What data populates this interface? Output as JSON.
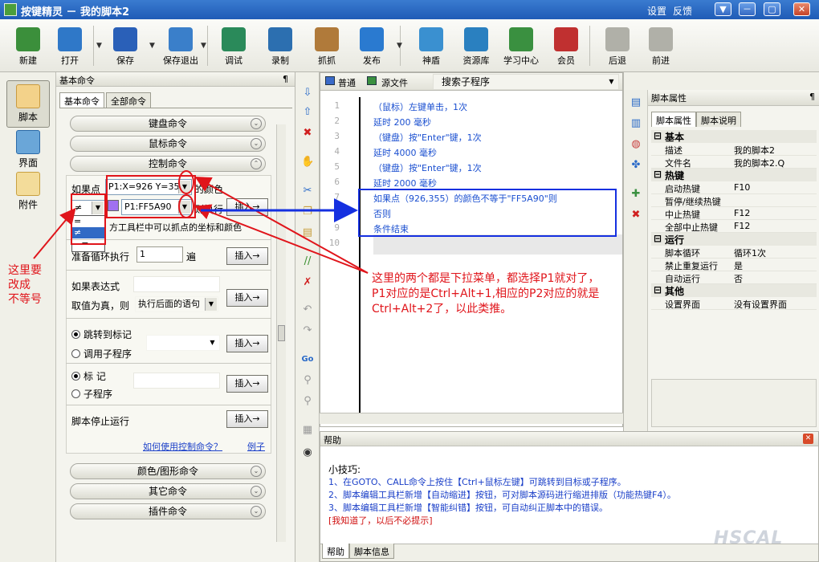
{
  "window": {
    "title": "按键精灵 － 我的脚本2",
    "settings_label": "设置",
    "feedback_label": "反馈",
    "min_label": "▼",
    "restore_label": "－",
    "max_label": "▢",
    "close_label": "✕"
  },
  "toolbar": {
    "items": [
      {
        "label": "新建",
        "icon": "new-file-icon",
        "color": "#3b8f3b"
      },
      {
        "label": "打开",
        "icon": "open-folder-icon",
        "color": "#2f78c8"
      },
      {
        "label": "保存",
        "icon": "save-disk-icon",
        "color": "#2a60b8"
      },
      {
        "label": "保存退出",
        "icon": "save-exit-icon",
        "color": "#3a7fca"
      },
      {
        "label": "调试",
        "icon": "debug-icon",
        "color": "#2a8a5a"
      },
      {
        "label": "录制",
        "icon": "record-camera-icon",
        "color": "#2c6fb0"
      },
      {
        "label": "抓抓",
        "icon": "grab-hand-icon",
        "color": "#b07a3a"
      },
      {
        "label": "发布",
        "icon": "publish-globe-icon",
        "color": "#2a7ad0"
      },
      {
        "label": "神盾",
        "icon": "shield-icon",
        "color": "#3a90d0"
      },
      {
        "label": "资源库",
        "icon": "resource-library-icon",
        "color": "#2a80c0"
      },
      {
        "label": "学习中心",
        "icon": "study-center-icon",
        "color": "#3a9040"
      },
      {
        "label": "会员",
        "icon": "member-icon",
        "color": "#c03030"
      },
      {
        "label": "后退",
        "icon": "back-arrow-icon",
        "color": "#b0b0a8"
      },
      {
        "label": "前进",
        "icon": "forward-arrow-icon",
        "color": "#b0b0a8"
      }
    ]
  },
  "leftbar": {
    "items": [
      {
        "label": "脚本",
        "icon": "script-icon"
      },
      {
        "label": "界面",
        "icon": "interface-icon"
      },
      {
        "label": "附件",
        "icon": "attachment-icon"
      }
    ]
  },
  "cmdpanel": {
    "title": "基本命令",
    "pin": "¶",
    "tabs": [
      "基本命令",
      "全部命令"
    ],
    "bars_top": [
      "键盘命令",
      "鼠标命令",
      "控制命令"
    ],
    "bars_bottom": [
      "颜色/图形命令",
      "其它命令",
      "插件命令"
    ],
    "if_point_label": "如果点",
    "point_select_value": "P1:X=926 Y=355",
    "color_suffix": "的颜色",
    "operator_select_value": "≠",
    "operator_options": [
      "=",
      "≠",
      "~="
    ],
    "color_select_value": "P1:FF5A90",
    "then_label": "则执行",
    "hint_text": "方工具栏中可以抓点的坐标和颜色",
    "loop_label": "准备循环执行",
    "loop_value": "1",
    "loop_unit": "遍",
    "expr_label": "如果表达式",
    "true_label": "取值为真，则",
    "true_select": "执行后面的语句",
    "jump_label": "跳转到标记",
    "call_label": "调用子程序",
    "mark_label": "标 记",
    "sub_label": "子程序",
    "stop_label": "脚本停止运行",
    "insert_label": "插入→",
    "howto_link": "如何使用控制命令？",
    "example_link": "例子"
  },
  "editor": {
    "tab_normal": "普通",
    "tab_source": "源文件",
    "search_label": "搜索子程序",
    "lines": [
      {
        "n": "1",
        "text": "（鼠标）左键单击，1次"
      },
      {
        "n": "2",
        "text": "延时 200 毫秒"
      },
      {
        "n": "3",
        "text": "（键盘）按\"Enter\"键，1次"
      },
      {
        "n": "4",
        "text": "延时 4000 毫秒"
      },
      {
        "n": "5",
        "text": "（键盘）按\"Enter\"键，1次"
      },
      {
        "n": "6",
        "text": "延时 2000 毫秒"
      },
      {
        "n": "7",
        "text": "如果点（926,355）的颜色不等于\"FF5A90\"则"
      },
      {
        "n": "8",
        "text": "否则"
      },
      {
        "n": "9",
        "text": "条件结束"
      },
      {
        "n": "10",
        "text": ""
      }
    ]
  },
  "props": {
    "title": "脚本属性",
    "tabs": [
      "脚本属性",
      "脚本说明"
    ],
    "groups": [
      {
        "name": "基本",
        "rows": [
          {
            "k": "描述",
            "v": "我的脚本2"
          },
          {
            "k": "文件名",
            "v": "我的脚本2.Q"
          }
        ]
      },
      {
        "name": "热键",
        "rows": [
          {
            "k": "启动热键",
            "v": "F10"
          },
          {
            "k": "暂停/继续热键",
            "v": ""
          },
          {
            "k": "中止热键",
            "v": "F12"
          },
          {
            "k": "全部中止热键",
            "v": "F12"
          }
        ]
      },
      {
        "name": "运行",
        "rows": [
          {
            "k": "脚本循环",
            "v": "循环1次"
          },
          {
            "k": "禁止重复运行",
            "v": "是"
          },
          {
            "k": "自动运行",
            "v": "否"
          }
        ]
      },
      {
        "name": "其他",
        "rows": [
          {
            "k": "设置界面",
            "v": "没有设置界面"
          }
        ]
      }
    ]
  },
  "help": {
    "title": "帮助",
    "tips": [
      "小技巧:",
      "1、在GOTO、CALL命令上按住【Ctrl+鼠标左键】可跳转到目标或子程序。",
      "2、脚本编辑工具栏新增【自动缩进】按钮，可对脚本源码进行缩进排版（功能热键F4）。",
      "3、脚本编辑工具栏新增【智能纠错】按钮，可自动纠正脚本中的错误。"
    ],
    "dismiss": "[我知道了，以后不必提示]",
    "tabs": [
      "帮助",
      "脚本信息"
    ],
    "watermark": "HSCAL"
  },
  "annotations": {
    "left_note": [
      "这里要",
      "改成",
      "不等号"
    ],
    "right_note": [
      "这里的两个都是下拉菜单，都选择P1就对了，",
      "P1对应的是Ctrl+Alt+1,相应的P2对应的就是",
      "Ctrl+Alt+2了，以此类推。"
    ],
    "accent_red": "#e0151b",
    "accent_blue": "#1530e0"
  }
}
